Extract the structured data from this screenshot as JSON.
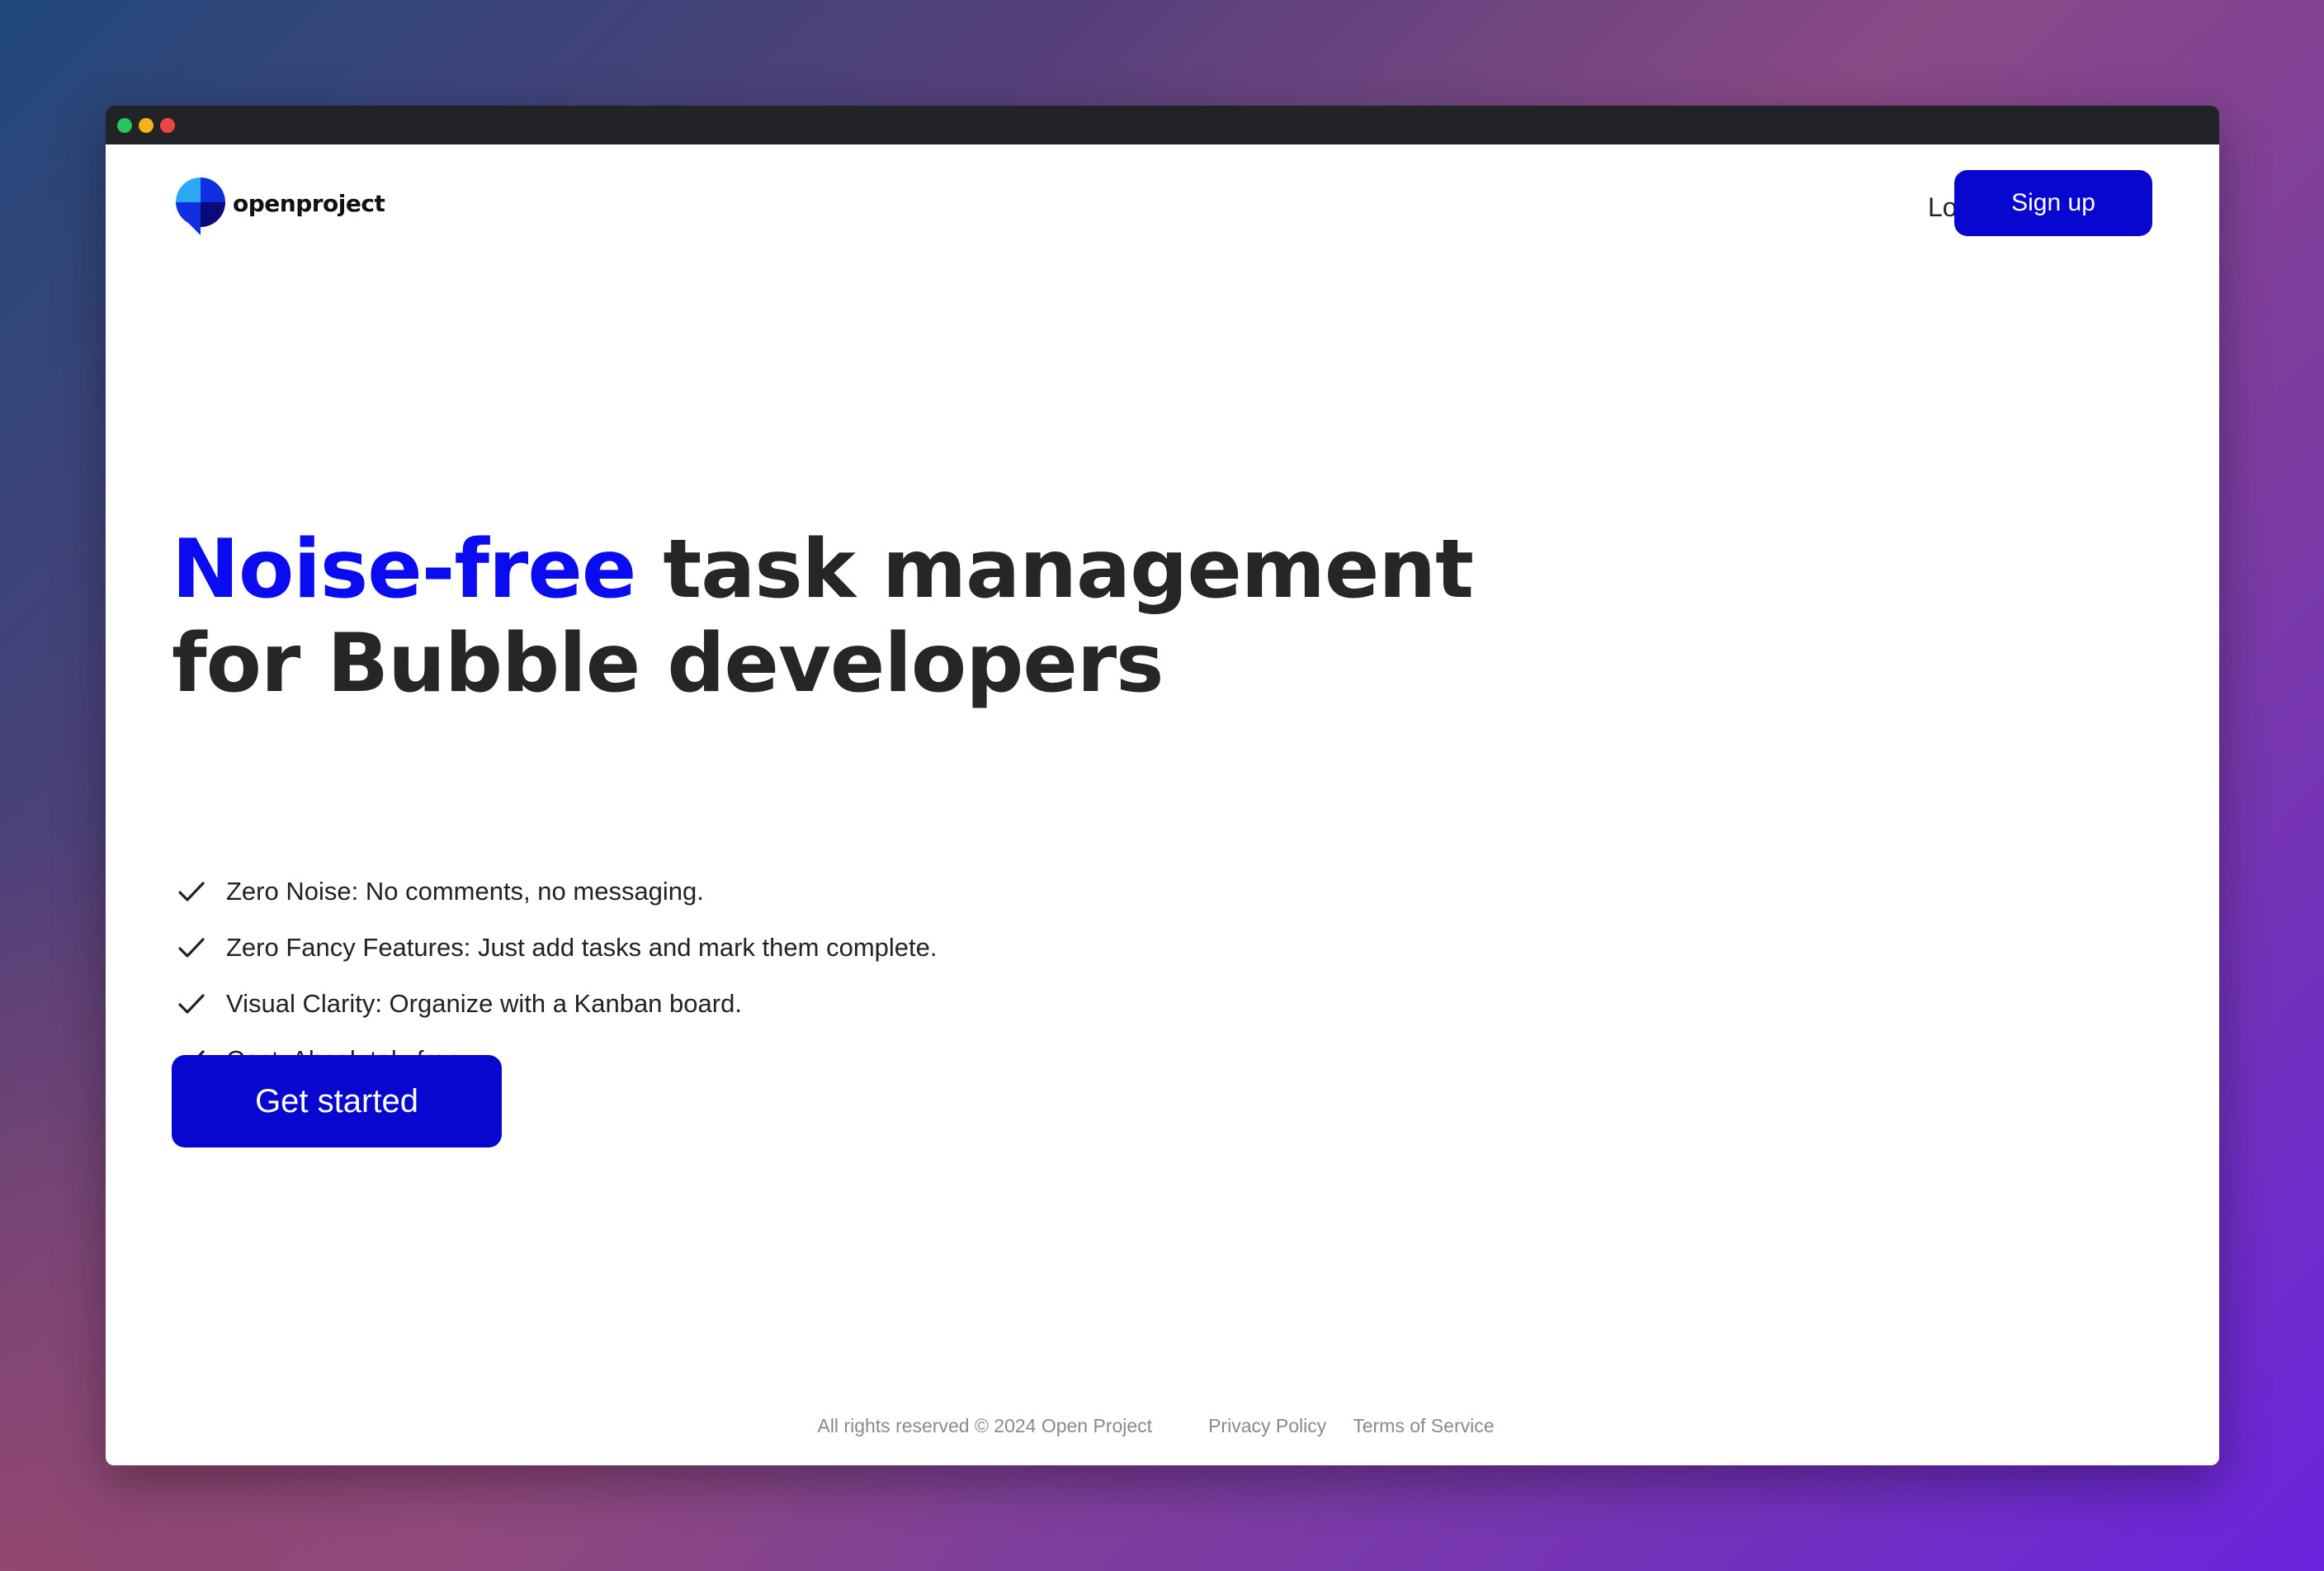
{
  "window": {
    "controls": [
      "green-dot",
      "yellow-dot",
      "red-dot"
    ]
  },
  "header": {
    "logo_text": "openproject",
    "login_label": "Log in",
    "signup_label": "Sign up"
  },
  "hero": {
    "headline_accent": "Noise-free",
    "headline_rest_1": " task management",
    "headline_rest_2": "for Bubble developers",
    "features": [
      "Zero Noise: No comments, no messaging.",
      "Zero Fancy Features: Just add tasks and mark them complete.",
      "Visual Clarity: Organize with a Kanban board.",
      "Cost: Absolutely free."
    ],
    "cta_label": "Get started"
  },
  "footer": {
    "copyright": "All rights reserved © 2024 Open Project",
    "privacy_label": "Privacy Policy",
    "terms_label": "Terms of Service"
  },
  "colors": {
    "brand": "#0707cf",
    "accent_text": "#0b0bf2",
    "logo_light_blue": "#2aa8f2",
    "logo_mid_blue": "#0f2fe0",
    "logo_navy": "#0a0a78",
    "heading": "#262626"
  }
}
